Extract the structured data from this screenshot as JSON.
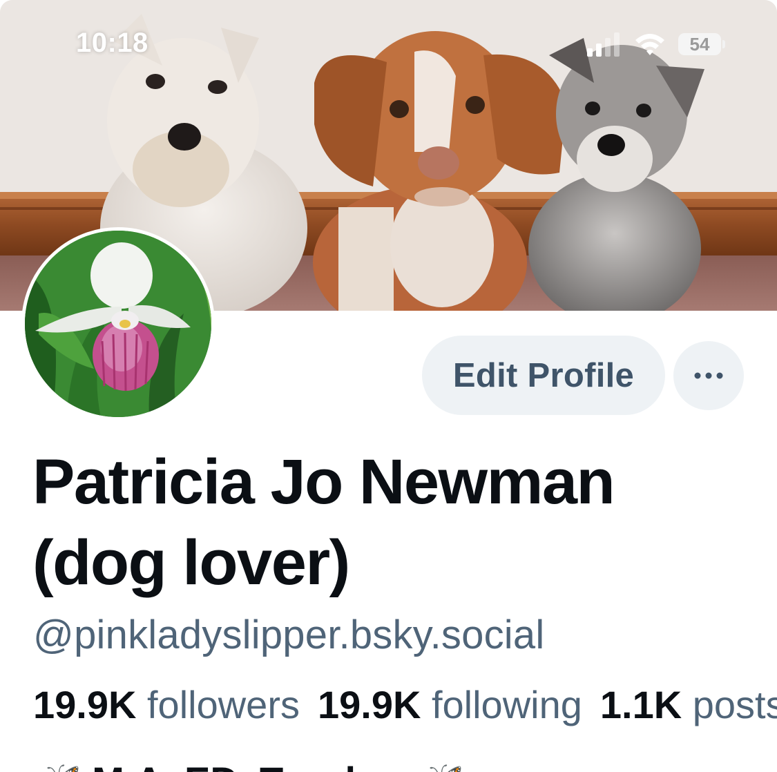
{
  "status_bar": {
    "time": "10:18",
    "battery_level": "54",
    "signal_icon": "cellular-signal-icon",
    "wifi_icon": "wifi-icon",
    "battery_icon": "battery-icon"
  },
  "profile": {
    "banner_image": "banner-photo-three-dogs",
    "avatar_image": "avatar-photo-lady-slipper-orchid",
    "display_name": "Patricia Jo Newman (dog lover)",
    "handle": "@pinkladyslipper.bsky.social",
    "stats": {
      "followers_count": "19.9K",
      "followers_label": "followers",
      "following_count": "19.9K",
      "following_label": "following",
      "posts_count": "1.1K",
      "posts_label": "posts"
    },
    "bio_partial": "🦋 M.A. ED. Teacher 🦋"
  },
  "actions": {
    "edit_profile_label": "Edit Profile",
    "more_label": "···",
    "more_icon": "ellipsis-icon"
  },
  "colors": {
    "button_bg": "#eef2f5",
    "button_text": "#3f5469",
    "secondary_text": "#4f6478",
    "primary_text": "#0b0f14"
  }
}
